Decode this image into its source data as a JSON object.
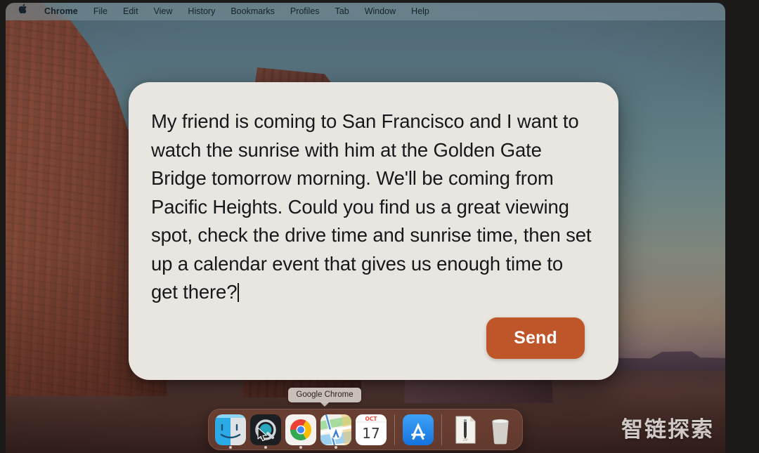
{
  "menubar": {
    "apple_glyph": "",
    "items": [
      {
        "label": "Chrome",
        "active": true
      },
      {
        "label": "File",
        "active": false
      },
      {
        "label": "Edit",
        "active": false
      },
      {
        "label": "View",
        "active": false
      },
      {
        "label": "History",
        "active": false
      },
      {
        "label": "Bookmarks",
        "active": false
      },
      {
        "label": "Profiles",
        "active": false
      },
      {
        "label": "Tab",
        "active": false
      },
      {
        "label": "Window",
        "active": false
      },
      {
        "label": "Help",
        "active": false
      }
    ]
  },
  "prompt_card": {
    "text": "My friend is coming to San Francisco and I want to watch the sunrise with him at the Golden Gate Bridge tomorrow morning. We'll be coming from Pacific Heights. Could you find us a great viewing spot, check the drive time and sunrise time, then set up a calendar event that gives us enough time to get there?",
    "caret_visible": true,
    "background_color": "#e9e5e1",
    "text_color": "#17181a",
    "send_label": "Send",
    "send_color": "#bf5629",
    "send_text_color": "#ffffff"
  },
  "dock": {
    "tooltip": "Google Chrome",
    "background_color": "#96584275",
    "items": [
      {
        "name": "finder",
        "label": "Finder",
        "running": true
      },
      {
        "name": "quicktime",
        "label": "QuickTime Player",
        "running": true
      },
      {
        "name": "chrome",
        "label": "Google Chrome",
        "running": true
      },
      {
        "name": "maps",
        "label": "Maps",
        "running": true
      },
      {
        "name": "calendar",
        "label": "Calendar",
        "running": false,
        "month": "OCT",
        "day": "17"
      },
      {
        "name": "separator",
        "label": "",
        "running": false
      },
      {
        "name": "appstore",
        "label": "App Store",
        "running": false
      },
      {
        "name": "separator",
        "label": "",
        "running": false
      },
      {
        "name": "document",
        "label": "Document",
        "running": false,
        "file_label": "ZIP"
      },
      {
        "name": "trash",
        "label": "Trash",
        "running": false
      }
    ]
  },
  "watermark": {
    "text": "智链探索"
  }
}
